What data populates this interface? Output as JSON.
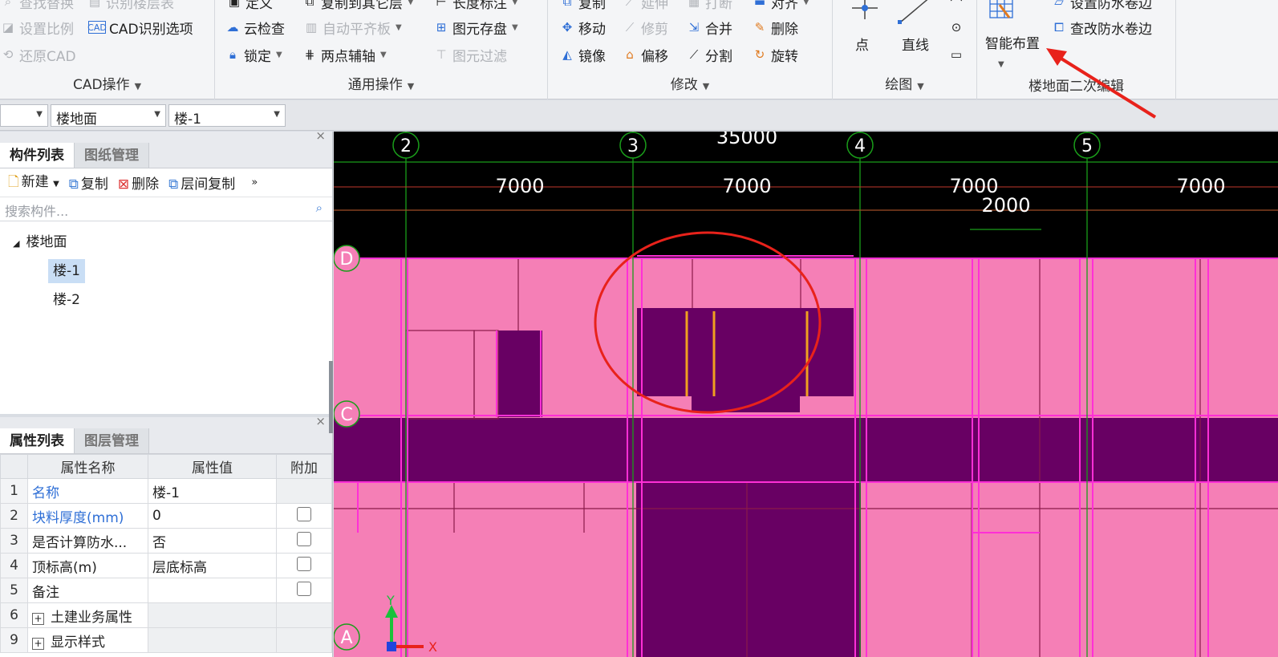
{
  "ribbon": {
    "cad_group": {
      "title": "CAD操作",
      "items": {
        "find_replace": "查找替换",
        "identify_floor_table": "识别楼层表",
        "set_scale": "设置比例",
        "cad_options": "CAD识别选项",
        "restore_cad": "还原CAD"
      }
    },
    "general_group": {
      "title": "通用操作",
      "items": {
        "define": "定义",
        "copy_to_other_floor": "复制到其它层",
        "length_dim": "长度标注",
        "cloud_check": "云检查",
        "auto_align_slab": "自动平齐板",
        "save_element": "图元存盘",
        "lock": "锁定",
        "two_point_axis": "两点辅轴",
        "element_filter": "图元过滤"
      }
    },
    "modify_group": {
      "title": "修改",
      "items": {
        "copy": "复制",
        "extend": "延伸",
        "break": "打断",
        "align": "对齐",
        "move": "移动",
        "trim": "修剪",
        "merge": "合并",
        "delete": "删除",
        "mirror": "镜像",
        "offset": "偏移",
        "split": "分割",
        "rotate": "旋转"
      }
    },
    "draw_group": {
      "title": "绘图",
      "items": {
        "point": "点",
        "line": "直线"
      }
    },
    "floor_edit_group": {
      "title": "楼地面二次编辑",
      "items": {
        "smart_layout": "智能布置",
        "set_waterproof_edge": "设置防水卷边",
        "check_waterproof_edge": "查改防水卷边"
      }
    }
  },
  "selectors": {
    "first": "",
    "category": "楼地面",
    "element": "楼-1"
  },
  "component_panel": {
    "tabs": [
      "构件列表",
      "图纸管理"
    ],
    "tools": {
      "new": "新建",
      "copy": "复制",
      "delete": "删除",
      "floor_copy": "层间复制"
    },
    "search_placeholder": "搜索构件...",
    "tree": {
      "root": "楼地面",
      "children": [
        "楼-1",
        "楼-2"
      ]
    }
  },
  "property_panel": {
    "tabs": [
      "属性列表",
      "图层管理"
    ],
    "headers": [
      "属性名称",
      "属性值",
      "附加"
    ],
    "rows": [
      {
        "num": "1",
        "name": "名称",
        "value": "楼-1"
      },
      {
        "num": "2",
        "name": "块料厚度(mm)",
        "value": "0"
      },
      {
        "num": "3",
        "name": "是否计算防水...",
        "value": "否"
      },
      {
        "num": "4",
        "name": "顶标高(m)",
        "value": "层底标高"
      },
      {
        "num": "5",
        "name": "备注",
        "value": ""
      },
      {
        "num": "6",
        "name": "土建业务属性",
        "value": ""
      },
      {
        "num": "9",
        "name": "显示样式",
        "value": ""
      }
    ]
  },
  "canvas": {
    "grid_axes": [
      "2",
      "3",
      "4",
      "5"
    ],
    "row_axes": [
      "D",
      "C",
      "A"
    ],
    "total_dim": "35000",
    "spans": [
      "7000",
      "7000",
      "7000",
      "7000"
    ],
    "sub_dim": "2000",
    "ucs": {
      "y": "Y",
      "x": "X"
    }
  },
  "colors": {
    "floor_fill": "#f57fb6",
    "selected_fill": "#680063",
    "grid_line": "#1a9d1a",
    "annotation": "#e8221b"
  }
}
